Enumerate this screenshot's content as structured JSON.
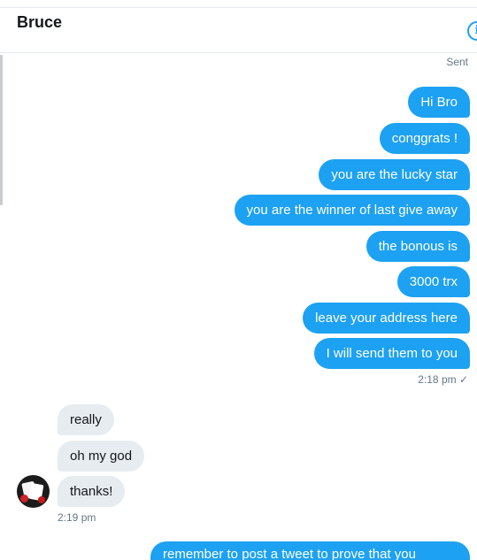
{
  "header": {
    "title": "Bruce",
    "info_icon": "info-circle-icon"
  },
  "status": {
    "sent": "Sent",
    "out_time": "2:18 pm ✓",
    "in_time": "2:19 pm"
  },
  "outgoing": [
    "Hi  Bro",
    "conggrats !",
    "you are the lucky star",
    "you are the winner of last give away",
    "the bonous is",
    "3000 trx",
    "leave your address here",
    "I will send them to you"
  ],
  "incoming": [
    "really",
    "oh my god",
    "thanks!"
  ],
  "partial_message": "remember to post a tweet to prove that you",
  "colors": {
    "accent": "#1da1f2",
    "incoming_bg": "#e6ecf0",
    "muted_text": "#657786"
  }
}
